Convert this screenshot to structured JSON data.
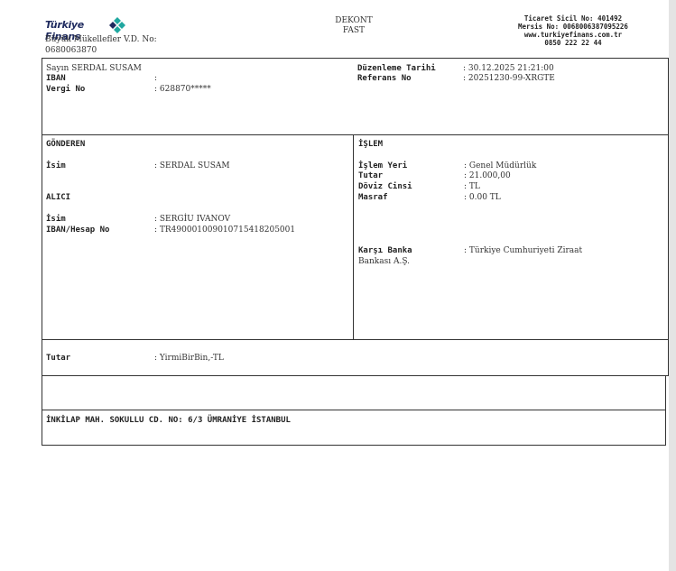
{
  "header": {
    "logo_text": "Türkiye Finans",
    "tax_office": "Büyük Mükellefler V.D. No:",
    "tax_no": "0680063870",
    "doc_title": "DEKONT",
    "doc_subtitle": "FAST",
    "trade_registry": "Ticaret Sicil No: 401492",
    "mersis": "Mersis No: 0068006387095226",
    "website": "www.turkiyefinans.com.tr",
    "phone": "0850 222 22 44",
    "brand_colors": [
      "#1e2a5e",
      "#1fa7a0"
    ]
  },
  "customer": {
    "salutation": "Sayın SERDAL SUSAM",
    "iban_label": "IBAN",
    "iban_value": ":",
    "tax_label": "Vergi No",
    "tax_value": ": 628870*****",
    "date_label": "Düzenleme Tarihi",
    "date_value": ": 30.12.2025 21:21:00",
    "ref_label": "Referans No",
    "ref_value": ": 20251230-99-XRGTE"
  },
  "sender": {
    "section_title": "GÖNDEREN",
    "name_label": "İsim",
    "name_value": ": SERDAL SUSAM"
  },
  "receiver": {
    "section_title": "ALICI",
    "name_label": "İsim",
    "name_value": ": SERGİU IVANOV",
    "iban_label": "IBAN/Hesap No",
    "iban_value": ": TR490001009010715418205001"
  },
  "transaction": {
    "section_title": "İŞLEM",
    "place_label": "İşlem Yeri",
    "place_value": ": Genel Müdürlük",
    "amount_label": "Tutar",
    "amount_value": ": 21.000,00",
    "currency_label": "Döviz Cinsi",
    "currency_value": ": TL",
    "fee_label": "Masraf",
    "fee_value": ": 0.00 TL",
    "bank_label": "Karşı Banka",
    "bank_value": ": Türkiye Cumhuriyeti Ziraat",
    "bank_value_cont": "Bankası A.Ş."
  },
  "amount_words": {
    "label": "Tutar",
    "value": ": YirmiBirBin,-TL"
  },
  "address": {
    "text": "İNKİLAP MAH. SOKULLU CD. NO: 6/3 ÜMRANİYE İSTANBUL"
  }
}
